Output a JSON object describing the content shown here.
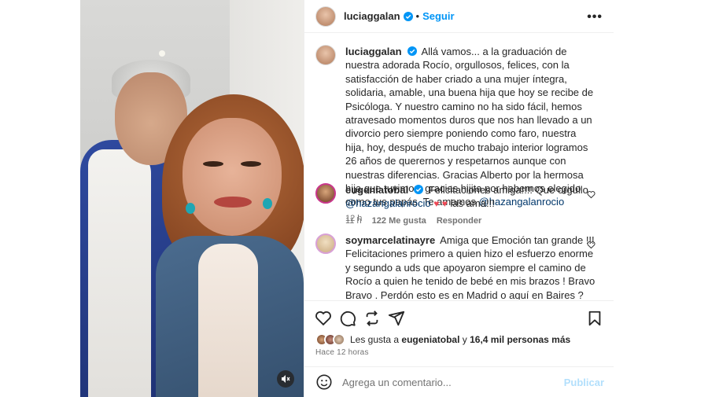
{
  "post": {
    "author": "luciaggalan",
    "follow_label": "Seguir",
    "separator": "•",
    "more_label": "•••",
    "caption": {
      "text": "Allá vamos... a la graduación de nuestra adorada Rocío, orgullosos, felices, con la satisfacción de haber criado a una mujer íntegra, solidaria, amable, una buena hija que hoy se recibe de Psicóloga. Y nuestro camino no ha sido fácil, hemos atravesado momentos duros que nos han llevado a un divorcio pero siempre poniendo como faro, nuestra hija, hoy, después de mucho trabajo interior logramos 26 años de querernos y respetarnos aunque con nuestras diferencias. Gracias Alberto por la hermosa hija que tuvimos, gracias hijita por habernos elegido como tus papás. Te amamos",
      "mention": "@hazangalanrocio",
      "time": "12 h"
    },
    "comments": [
      {
        "user": "eugeniatobal",
        "text": "Felicitaciones amiga!!!! Que orgullo",
        "mention": "@hazangalanrocio",
        "hearts": "♥ ♥",
        "tail": "las ama!!!",
        "time": "11 h",
        "likes": "122 Me gusta",
        "reply": "Responder"
      },
      {
        "user": "soymarcelatinayre",
        "text": "Amiga que Emoción tan grande !!! Felicitaciones primero a quien hizo el esfuerzo enorme y segundo a uds que apoyaron siempre el camino de Rocío a quien he tenido de bebé en mis brazos ! Bravo Bravo . Perdón esto es en Madrid o aquí en Baires ?"
      }
    ],
    "likes": {
      "prefix": "Les gusta a",
      "user": "eugeniatobal",
      "middle": "y",
      "count": "16,4 mil personas más"
    },
    "timestamp": "Hace 12 horas",
    "add_comment": {
      "placeholder": "Agrega un comentario...",
      "publish": "Publicar"
    },
    "colors": {
      "link": "#0095f6",
      "mention": "#00376b",
      "heart": "#ed4956",
      "muted": "#737373"
    },
    "icons": [
      "verified-badge-icon",
      "more-options-icon",
      "like-icon",
      "comment-icon",
      "share-icon",
      "save-icon",
      "emoji-icon",
      "mute-icon",
      "small-heart-icon"
    ]
  }
}
